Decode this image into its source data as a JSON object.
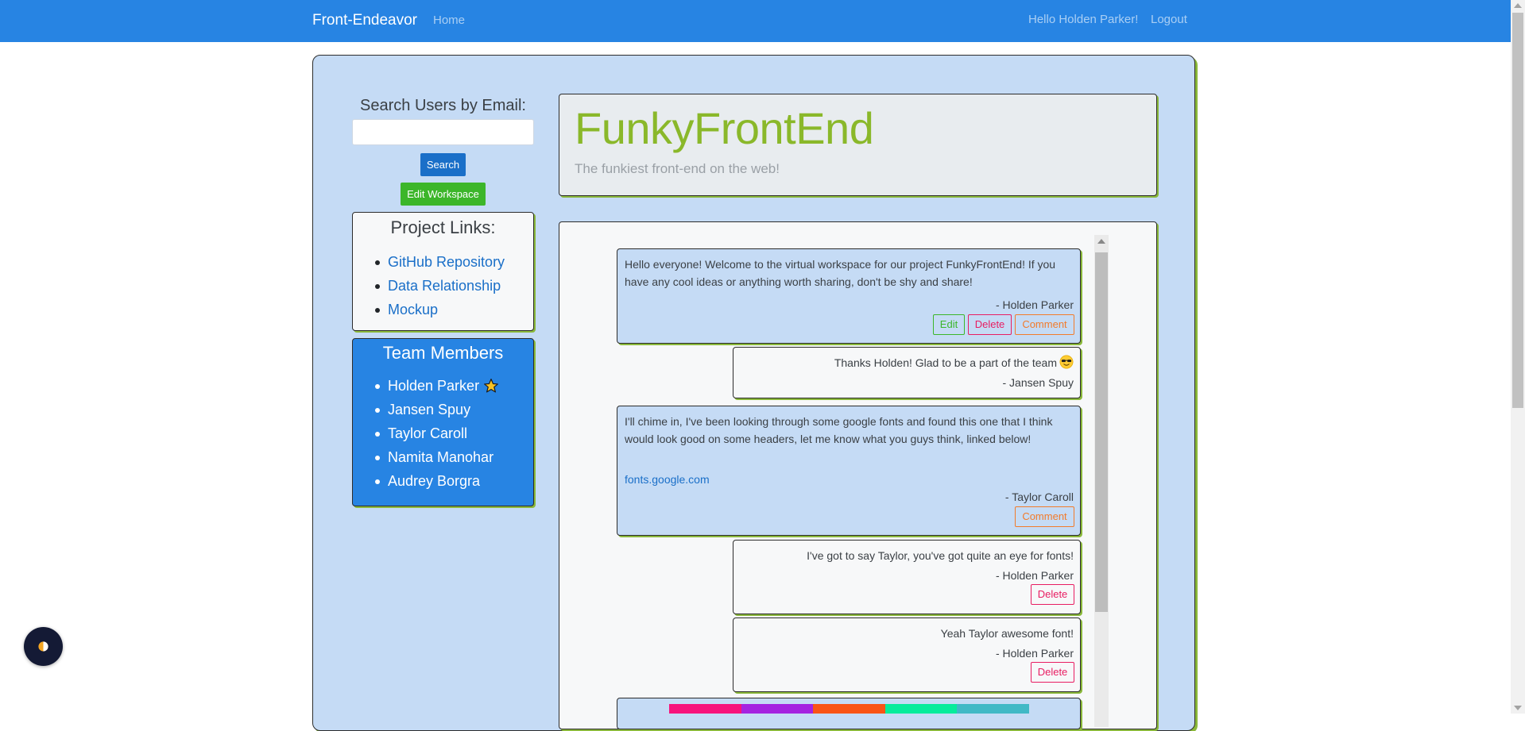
{
  "navbar": {
    "brand": "Front-Endeavor",
    "home": "Home",
    "greeting": "Hello Holden Parker!",
    "logout": "Logout"
  },
  "sidebar": {
    "search_label": "Search Users by Email:",
    "search_value": "",
    "search_button": "Search",
    "edit_workspace_button": "Edit Workspace",
    "links_title": "Project Links:",
    "links": [
      "GitHub Repository",
      "Data Relationship",
      "Mockup"
    ],
    "team_title": "Team Members",
    "team": [
      "Holden Parker",
      "Jansen Spuy",
      "Taylor Caroll",
      "Namita Manohar",
      "Audrey Borgra"
    ]
  },
  "jumbotron": {
    "title": "FunkyFrontEnd",
    "subtitle": "The funkiest front-end on the web!"
  },
  "messages": [
    {
      "text": "Hello everyone! Welcome to the virtual workspace for our project FunkyFrontEnd! If you have any cool ideas or anything worth sharing, don't be shy and share!",
      "author": "- Holden Parker",
      "actions": [
        "Edit",
        "Delete",
        "Comment"
      ]
    },
    {
      "text": "Thanks Holden! Glad to be a part of the team",
      "author": "- Jansen Spuy",
      "actions": []
    },
    {
      "text": "I'll chime in, I've been looking through some google fonts and found this one that I think would look good on some headers, let me know what you guys think, linked below!",
      "link": "fonts.google.com",
      "author": "- Taylor Caroll",
      "actions": [
        "Comment"
      ]
    },
    {
      "text": "I've got to say Taylor, you've got quite an eye for fonts!",
      "author": "- Holden Parker",
      "actions": [
        "Delete"
      ]
    },
    {
      "text": "Yeah Taylor awesome font!",
      "author": "- Holden Parker",
      "actions": [
        "Delete"
      ]
    }
  ],
  "colors": {
    "navbar": "#2784e3",
    "workspace_bg": "#c5dbf5",
    "accent_green": "#8ab83a",
    "palette_strip": [
      "#f7137c",
      "#a523e0",
      "#f95416",
      "#06ec9c",
      "#41b9c6"
    ]
  },
  "icons": [
    "star-icon",
    "sunglasses-emoji-icon",
    "theme-toggle-icon"
  ]
}
